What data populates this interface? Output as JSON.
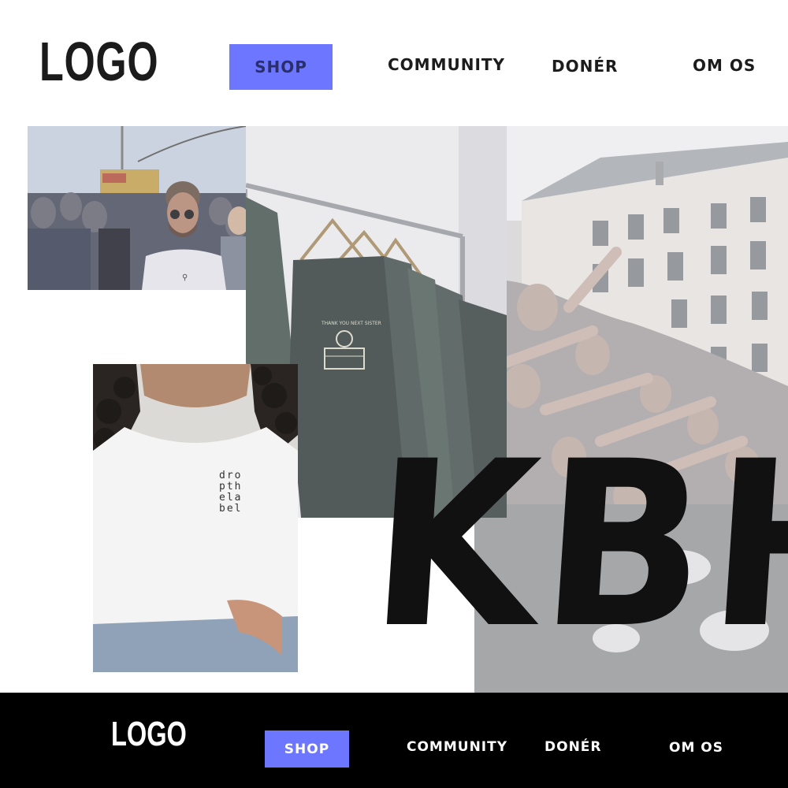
{
  "header": {
    "logo": "LOGO",
    "nav": {
      "shop": "SHOP",
      "community": "COMMUNITY",
      "doner": "DONÉR",
      "om_os": "OM OS"
    }
  },
  "hero": {
    "headline": "KBH",
    "tee_print": "dro\npth\nela\nbel"
  },
  "footer": {
    "logo": "LOGO",
    "nav": {
      "shop": "SHOP",
      "community": "COMMUNITY",
      "doner": "DONÉR",
      "om_os": "OM OS"
    }
  },
  "colors": {
    "accent": "#6c76ff",
    "footer_bg": "#000000",
    "text": "#1c1c1c"
  }
}
